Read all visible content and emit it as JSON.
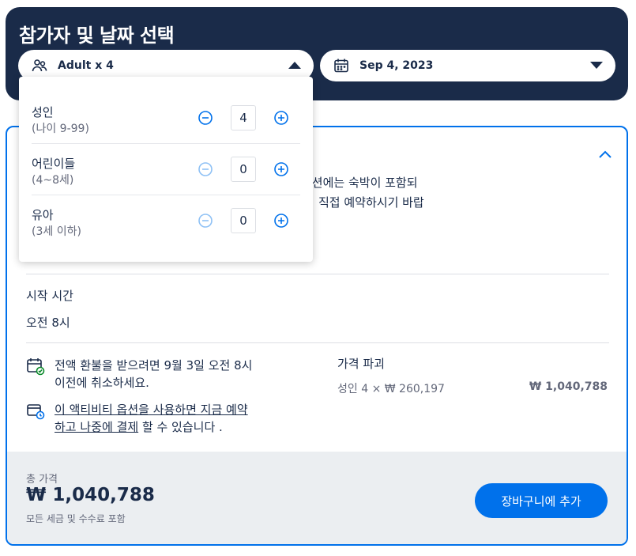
{
  "header": {
    "title": "참가자 및 날짜 선택",
    "participants_label": "Adult x 4",
    "date_label": "Sep 4, 2023"
  },
  "participants": [
    {
      "name": "성인",
      "sub": "(나이 9-99)",
      "count": "4",
      "minus_enabled": true
    },
    {
      "name": "어린이들",
      "sub": "(4~8세)",
      "count": "0",
      "minus_enabled": false
    },
    {
      "name": "유아",
      "sub": "(3세 이하)",
      "count": "0",
      "minus_enabled": false
    }
  ],
  "option": {
    "partial_text_1": "옵션에는 숙박이 포함되",
    "partial_text_2": "직접 예약하시기 바랍",
    "start_label": "시작 시간",
    "start_value": "오전 8시",
    "refund_text_1": "전액 환불을 받으려면 9월 3일 오전 8시",
    "refund_text_2": "이전에 취소하세요.",
    "pay_later_link_1": "이 액티비티 옵션을 사용하면 지금 예약",
    "pay_later_link_2": "하고 나중에 결제",
    "pay_later_rest": " 할 수 있습니다 .",
    "price_title": "가격 파괴",
    "price_line": "성인 4 × ₩ 260,197",
    "price_amount": "₩ 1,040,788"
  },
  "footer": {
    "total_label": "총 가격",
    "total_value": "₩ 1,040,788",
    "tax_note": "모든 세금 및 수수료 포함",
    "add_to_cart": "장바구니에 추가"
  },
  "colors": {
    "navy": "#1a2b49",
    "accent": "#0071eb",
    "footer_bg": "#ebeef1"
  }
}
